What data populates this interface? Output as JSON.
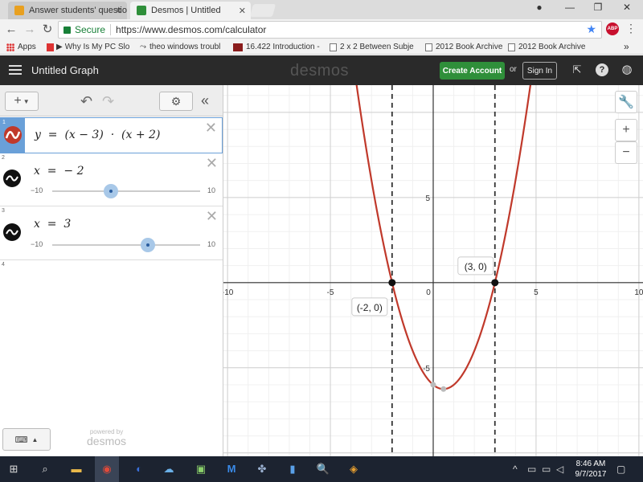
{
  "browser": {
    "tabs": [
      {
        "title": "Answer students' questio",
        "active": false,
        "icon": "answer-tab-icon"
      },
      {
        "title": "Desmos | Untitled",
        "active": true,
        "icon": "desmos-tab-icon"
      }
    ],
    "secure_label": "Secure",
    "url": "https://www.desmos.com/calculator",
    "bookmarks": [
      {
        "label": "Apps",
        "icon": "apps-grid-icon"
      },
      {
        "label": "Why Is My PC Slow",
        "icon": "play-icon"
      },
      {
        "label": "theo windows trouble",
        "icon": "bookmark-icon"
      },
      {
        "label": "16.422 Introduction -",
        "icon": "mit-icon"
      },
      {
        "label": "2 x 2 Between Subjec",
        "icon": "page-icon"
      },
      {
        "label": "2012 Book Archive",
        "icon": "page-icon"
      },
      {
        "label": "2012 Book Archive",
        "icon": "page-icon"
      }
    ],
    "overflow_label": "»",
    "abp_label": "ABP"
  },
  "desmos": {
    "graph_title": "Untitled Graph",
    "logo": "desmos",
    "create_account": "Create Account",
    "or": "or",
    "sign_in": "Sign In",
    "expressions": [
      {
        "index": "1",
        "latex_display": "y  =  (x − 3)  ·  (x + 2)",
        "color": "#c0392b",
        "selected": true
      },
      {
        "index": "2",
        "latex_display": "x  =  − 2",
        "slider": {
          "min": "−10",
          "max": "10",
          "value": -2
        }
      },
      {
        "index": "3",
        "latex_display": "x  =  3",
        "slider": {
          "min": "−10",
          "max": "10",
          "value": 3
        }
      }
    ],
    "empty_index": "4",
    "powered_by": "powered by",
    "powered_logo": "desmos"
  },
  "chart_data": {
    "type": "line",
    "xlim": [
      -10.2,
      10.2
    ],
    "ylim": [
      -10.2,
      11.6
    ],
    "x_ticks": [
      -10,
      -5,
      0,
      5,
      10
    ],
    "y_ticks": [
      -5,
      5
    ],
    "grid": true,
    "curve": {
      "expr": "(x-3)*(x+2)",
      "color": "#c0392b"
    },
    "vertical_lines": [
      -2,
      3
    ],
    "points": [
      {
        "x": -2,
        "y": 0,
        "label": "(-2, 0)"
      },
      {
        "x": 3,
        "y": 0,
        "label": "(3, 0)"
      }
    ],
    "extra_points": [
      {
        "x": 0,
        "y": -6
      },
      {
        "x": 0.5,
        "y": -6.25
      }
    ]
  },
  "taskbar": {
    "time": "8:46 AM",
    "date": "9/7/2017"
  }
}
